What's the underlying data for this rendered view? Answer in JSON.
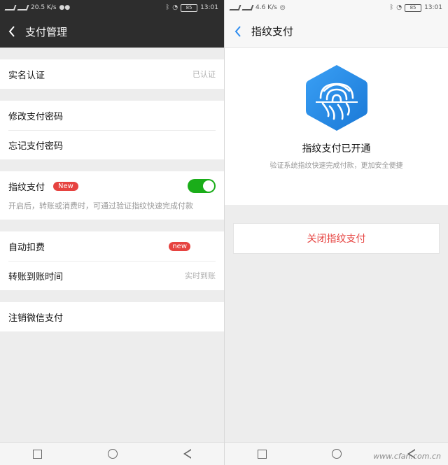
{
  "left": {
    "status_left": "20.5 K/s",
    "status_time": "13:01",
    "battery": "85",
    "title": "支付管理",
    "realname": {
      "label": "实名认证",
      "value": "已认证"
    },
    "change_pwd": "修改支付密码",
    "forgot_pwd": "忘记支付密码",
    "fingerprint": {
      "label": "指纹支付",
      "badge": "New",
      "desc": "开启后，转账或消费时，可通过验证指纹快速完成付款"
    },
    "auto_deduct": {
      "label": "自动扣费",
      "badge": "new"
    },
    "transfer_time": {
      "label": "转账到账时间",
      "value": "实时到账"
    },
    "cancel": "注销微信支付"
  },
  "right": {
    "status_left": "4.6 K/s",
    "status_time": "13:01",
    "battery": "85",
    "title": "指纹支付",
    "enabled_title": "指纹支付已开通",
    "enabled_sub": "验证系统指纹快速完成付款，更加安全便捷",
    "close_button": "关闭指纹支付",
    "watermark": "www.cfan.com.cn"
  },
  "colors": {
    "wechat_green": "#1aad19",
    "accent_red": "#e64340",
    "blue_accent": "#2f8df0"
  }
}
